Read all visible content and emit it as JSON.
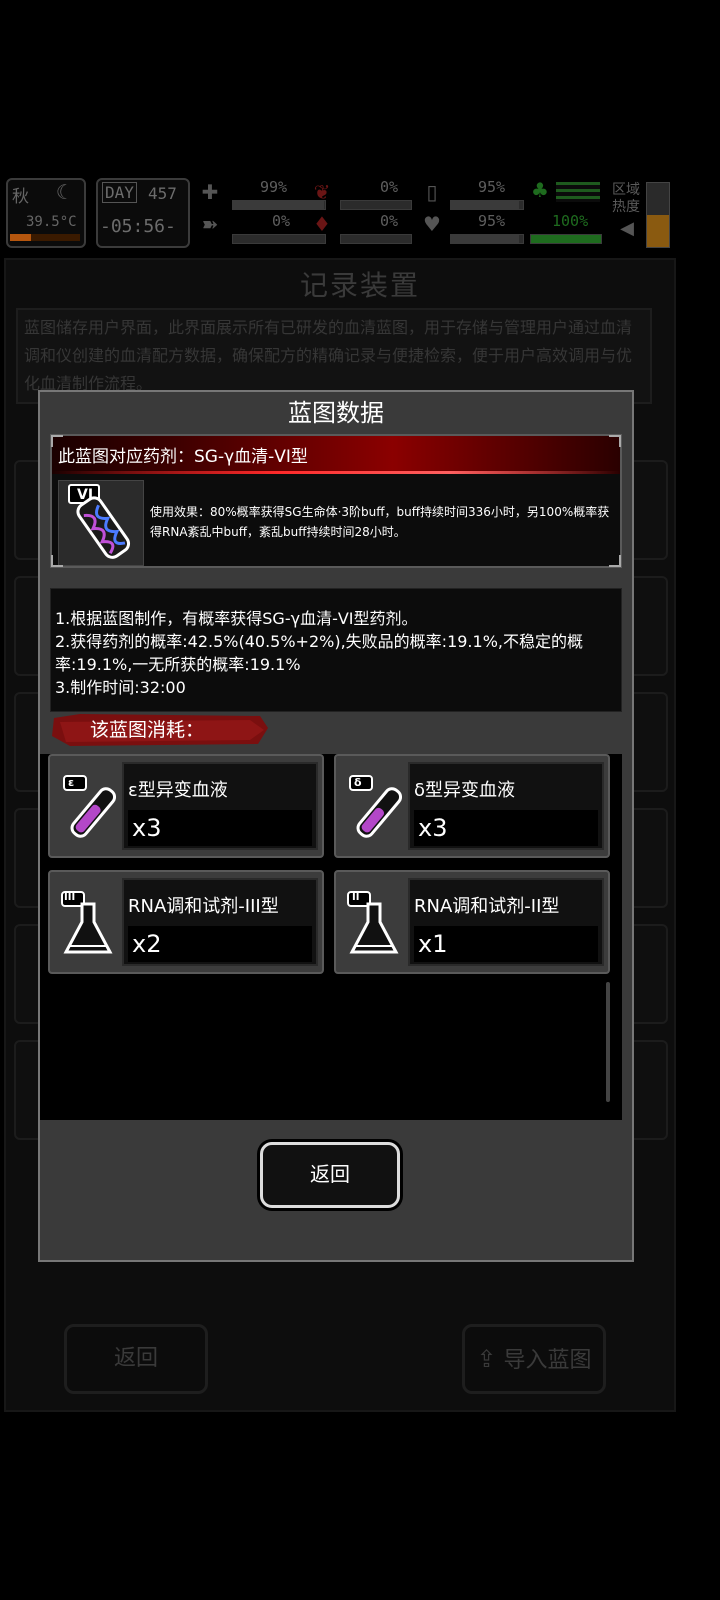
{
  "hud": {
    "season": "秋",
    "day_label": "DAY",
    "day_number": "457",
    "temperature": "39.5°C",
    "time": "-05:56-",
    "stat1_top": "99%",
    "stat1_bottom": "0%",
    "stat2_top": "0%",
    "stat2_bottom": "0%",
    "stat3_top": "95%",
    "stat3_bottom": "95%",
    "stat4_bottom": "100%",
    "region_label": "区域热度",
    "bars": [
      {
        "level": 0.99,
        "color": "#3a3a3a"
      },
      {
        "level": 0.0,
        "color": "#3a3a3a"
      },
      {
        "level": 0.0,
        "color": "#3a3a3a"
      },
      {
        "level": 0.0,
        "color": "#3a3a3a"
      },
      {
        "level": 0.95,
        "color": "#3a3a3a"
      },
      {
        "level": 0.95,
        "color": "#3a3a3a"
      },
      {
        "level": 1.0,
        "color": "#1e6b1e"
      }
    ]
  },
  "background": {
    "title": "记录装置",
    "description": "蓝图储存用户界面，此界面展示所有已研发的血清蓝图，用于存储与管理用户通过血清调和仪创建的血清配方数据，确保配方的精确记录与便捷检索，便于用户高效调用与优化血清制作流程。",
    "back_label": "返回",
    "import_label": "导入蓝图"
  },
  "modal": {
    "title": "蓝图数据",
    "reference_label": "此蓝图对应药剂：SG-γ血清-VI型",
    "potion_badge": "VI",
    "effect_text": "使用效果：80%概率获得SG生命体·3阶buff，buff持续时间336小时，另100%概率获得RNA紊乱中buff，紊乱buff持续时间28小时。",
    "info_lines": [
      "1.根据蓝图制作，有概率获得SG-γ血清-VI型药剂。",
      "2.获得药剂的概率:42.5%(40.5%+2%),失败品的概率:19.1%,不稳定的概率:19.1%,一无所获的概率:19.1%",
      "3.制作时间:32:00"
    ],
    "cost_title": "该蓝图消耗：",
    "costs": [
      {
        "name": "ε型异变血液",
        "qty": "x3",
        "badge": "ε",
        "icon": "test-tube-icon"
      },
      {
        "name": "δ型异变血液",
        "qty": "x3",
        "badge": "δ",
        "icon": "test-tube-icon"
      },
      {
        "name": "RNA调和试剂-III型",
        "qty": "x2",
        "badge": "III",
        "icon": "flask-icon"
      },
      {
        "name": "RNA调和试剂-II型",
        "qty": "x1",
        "badge": "II",
        "icon": "flask-icon"
      }
    ],
    "return_label": "返回"
  }
}
